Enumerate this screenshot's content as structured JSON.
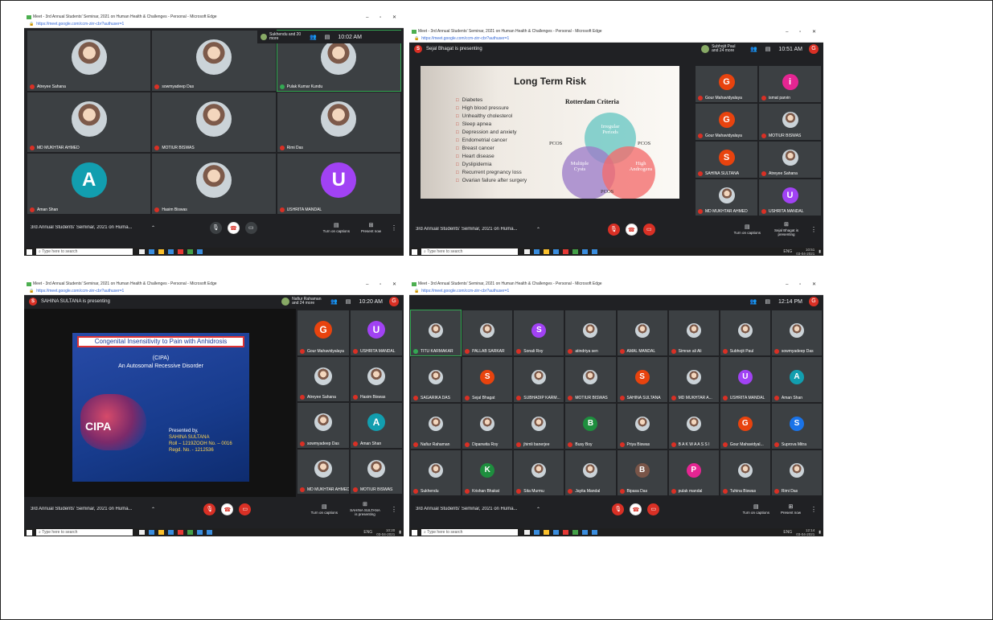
{
  "screens": [
    {
      "title": "Meet - 3rd Annual Students' Seminar, 2021 on Human Health & Challenges - Personal - Microsoft Edge",
      "url": "https://meet.google.com/ccm-zirr-cbr?authuser=1",
      "others": "Sukhendu and 20 more",
      "time": "10:02 AM",
      "participants": [
        {
          "name": "Atreyee Sahana",
          "initial": "",
          "color": "",
          "mic": "off"
        },
        {
          "name": "sowmyadeep Das",
          "initial": "",
          "color": "",
          "mic": "off"
        },
        {
          "name": "Pulak Kumar Kundu",
          "initial": "",
          "color": "",
          "mic": "on"
        },
        {
          "name": "MD MUKHTAR AHMED",
          "initial": "",
          "color": "",
          "mic": "off"
        },
        {
          "name": "MOTIUR BISWAS",
          "initial": "",
          "color": "",
          "mic": "off"
        },
        {
          "name": "Rimi Das",
          "initial": "",
          "color": "",
          "mic": "off"
        },
        {
          "name": "Aman Shan",
          "initial": "A",
          "color": "#129eaf",
          "mic": "off"
        },
        {
          "name": "Hasim Biswas",
          "initial": "",
          "color": "",
          "mic": "off"
        },
        {
          "name": "USHRITA MANDAL",
          "initial": "U",
          "color": "#a142f4",
          "mic": "off"
        }
      ],
      "meeting_title": "3rd Annual Students' Seminar, 2021 on Huma...",
      "captions": "Turn on captions",
      "present": "Present now",
      "search": "Type here to search"
    },
    {
      "title": "Meet - 3rd Annual Students' Seminar, 2021 on Human Health & Challenges - Personal - Microsoft Edge",
      "url": "https://meet.google.com/ccm-zirr-cbr?authuser=1",
      "presenting": "Sejal Bhagat is presenting",
      "presenter_initial": "S",
      "others": "Subhojit Paul and 24 more",
      "time": "10:51 AM",
      "slide": {
        "title": "Long Term Risk",
        "items": [
          "Diabetes",
          "High blood pressure",
          "Unhealthy cholesterol",
          "Sleep apnea",
          "Depression and anxiety",
          "Endometrial cancer",
          "Breast cancer",
          "Heart disease",
          "Dyslipidemia",
          "Recurrent pregnancy loss",
          "Ovarian failure after surgery"
        ],
        "diagram_title": "Rotterdam Criteria",
        "circle_a": "Irregular Periods",
        "circle_b": "Multiple Cysts",
        "circle_c": "High Androgens",
        "overlap": "PCOS"
      },
      "participants": [
        {
          "name": "Gour Mahavidyalaya",
          "initial": "G",
          "color": "#e8430e"
        },
        {
          "name": "ismat parvin",
          "initial": "i",
          "color": "#e52592"
        },
        {
          "name": "Gour Mahavidyalaya",
          "initial": "G",
          "color": "#e8430e"
        },
        {
          "name": "MOTIUR BISWAS",
          "initial": "",
          "color": ""
        },
        {
          "name": "SAHINA SULTANA",
          "initial": "S",
          "color": "#e8430e"
        },
        {
          "name": "Atreyee Sahana",
          "initial": "",
          "color": ""
        },
        {
          "name": "MD MUKHTAR AHMED",
          "initial": "",
          "color": ""
        },
        {
          "name": "USHRITA MANDAL",
          "initial": "U",
          "color": "#a142f4"
        }
      ],
      "meeting_title": "3rd Annual Students' Seminar, 2021 on Huma...",
      "captions": "Turn on captions",
      "present": "Sejal Bhagat is presenting",
      "search": "Type here to search",
      "tray_time": "10:51",
      "tray_date": "03-04-2021"
    },
    {
      "title": "Meet - 3rd Annual Students' Seminar, 2021 on Human Health & Challenges - Personal - Microsoft Edge",
      "url": "https://meet.google.com/ccm-zirr-cbr?authuser=1",
      "presenting": "SAHINA SULTANA is presenting",
      "presenter_initial": "S",
      "others": "Nafiur Rahaman and 24 more",
      "time": "10:20 AM",
      "slide": {
        "title": "Congenital Insensitivity to Pain with Anhidrosis",
        "line1": "(CIPA)",
        "line2": "An Autosomal Recessive Disorder",
        "logo": "CIPA",
        "presented_by": "Presented by,",
        "presenter": "SAHINA SULTANA",
        "roll": "Roll – 1219ZOOH No. – 0016",
        "regd": "Regd. No. - 1212536"
      },
      "participants": [
        {
          "name": "Gour Mahavidyalaya",
          "initial": "G",
          "color": "#e8430e"
        },
        {
          "name": "USHRITA MANDAL",
          "initial": "U",
          "color": "#a142f4"
        },
        {
          "name": "Atreyee Sahana",
          "initial": "",
          "color": ""
        },
        {
          "name": "Hasim Biswas",
          "initial": "",
          "color": ""
        },
        {
          "name": "sowmyadeep Das",
          "initial": "",
          "color": ""
        },
        {
          "name": "Aman Shan",
          "initial": "A",
          "color": "#129eaf"
        },
        {
          "name": "MD MUKHTAR AHMED",
          "initial": "",
          "color": ""
        },
        {
          "name": "MOTIUR BISWAS",
          "initial": "",
          "color": ""
        }
      ],
      "meeting_title": "3rd Annual Students' Seminar, 2021 on Huma...",
      "captions": "Turn on captions",
      "present": "SAHINA SULTANA is presenting",
      "search": "Type here to search",
      "tray_time": "10:20",
      "tray_date": "03-04-2021"
    },
    {
      "title": "Meet - 3rd Annual Students' Seminar, 2021 on Human Health & Challenges - Personal - Microsoft Edge",
      "url": "https://meet.google.com/ccm-zirr-cbr?authuser=1",
      "time": "12:14 PM",
      "participants": [
        {
          "name": "TITU KARMAKAR",
          "initial": "",
          "color": "",
          "mic": "on"
        },
        {
          "name": "PALLAB SARKAR",
          "initial": "",
          "color": ""
        },
        {
          "name": "Sonali Roy",
          "initial": "S",
          "color": "#a142f4"
        },
        {
          "name": "atindriya sen",
          "initial": "",
          "color": ""
        },
        {
          "name": "AMAL MANDAL",
          "initial": "",
          "color": ""
        },
        {
          "name": "Simran ali Ali",
          "initial": "",
          "color": ""
        },
        {
          "name": "Subhojit Paul",
          "initial": "",
          "color": ""
        },
        {
          "name": "sowmyadeep Das",
          "initial": "",
          "color": ""
        },
        {
          "name": "SAGARIKA DAS",
          "initial": "",
          "color": ""
        },
        {
          "name": "Sejal Bhagat",
          "initial": "S",
          "color": "#e8430e"
        },
        {
          "name": "SUBHADIP KARM...",
          "initial": "",
          "color": ""
        },
        {
          "name": "MOTIUR BISWAS",
          "initial": "",
          "color": ""
        },
        {
          "name": "SAHINA SULTANA",
          "initial": "S",
          "color": "#e8430e"
        },
        {
          "name": "MD MUKHTAR A...",
          "initial": "",
          "color": ""
        },
        {
          "name": "USHRITA MANDAL",
          "initial": "U",
          "color": "#a142f4"
        },
        {
          "name": "Aman Shan",
          "initial": "A",
          "color": "#129eaf"
        },
        {
          "name": "Nafiur Rahaman",
          "initial": "",
          "color": ""
        },
        {
          "name": "Dipanwita Roy",
          "initial": "",
          "color": ""
        },
        {
          "name": "jhimli banerjee",
          "initial": "",
          "color": ""
        },
        {
          "name": "Busy Boy",
          "initial": "B",
          "color": "#1e8e3e"
        },
        {
          "name": "Priya Biswas",
          "initial": "",
          "color": ""
        },
        {
          "name": "B A K W A A S S I",
          "initial": "",
          "color": ""
        },
        {
          "name": "Gour Mahavidyal...",
          "initial": "G",
          "color": "#e8430e"
        },
        {
          "name": "Suprova Mitra",
          "initial": "S",
          "color": "#1a73e8"
        },
        {
          "name": "Sukhendu",
          "initial": "",
          "color": ""
        },
        {
          "name": "Krishan Bhakat",
          "initial": "K",
          "color": "#1e8e3e"
        },
        {
          "name": "Sita Murmu",
          "initial": "",
          "color": ""
        },
        {
          "name": "Jayita Mandal",
          "initial": "",
          "color": ""
        },
        {
          "name": "Bipasa Das",
          "initial": "B",
          "color": "#795548"
        },
        {
          "name": "pulak mandal",
          "initial": "P",
          "color": "#e52592"
        },
        {
          "name": "Tuhina Biswas",
          "initial": "",
          "color": ""
        },
        {
          "name": "Rimi Das",
          "initial": "",
          "color": ""
        }
      ],
      "meeting_title": "3rd Annual Students' Seminar, 2021 on Huma...",
      "captions": "Turn on captions",
      "present": "Present now",
      "search": "Type here to search",
      "tray_time": "12:14",
      "tray_date": "03-04-2021"
    }
  ],
  "labels": {
    "you": "You",
    "eng": "ENG"
  }
}
